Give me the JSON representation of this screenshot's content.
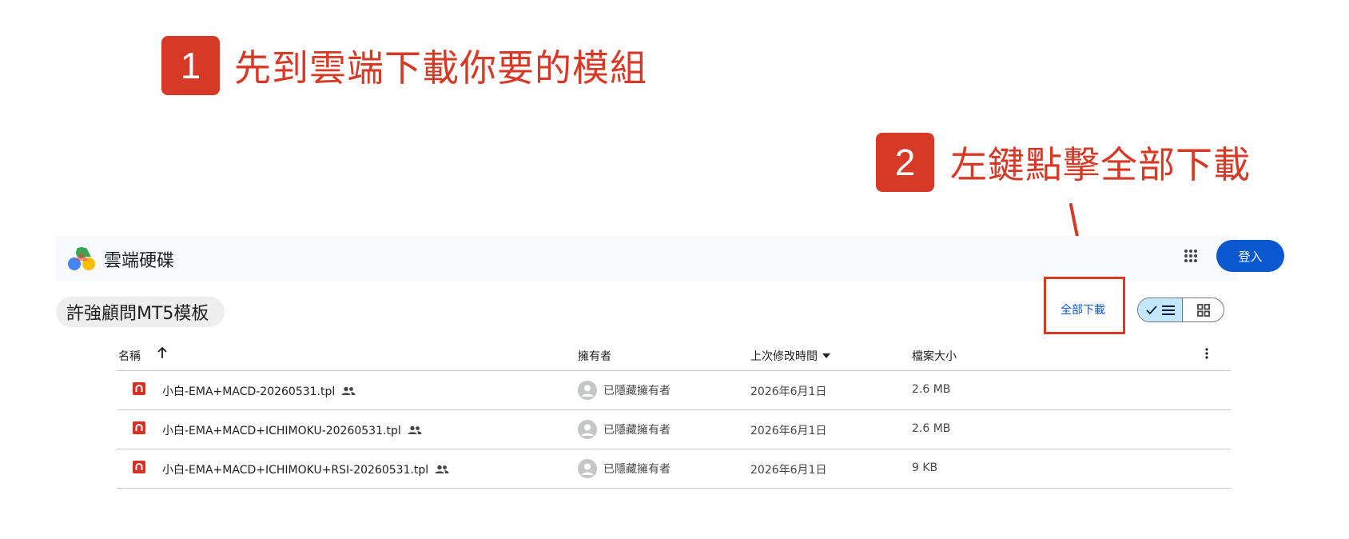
{
  "steps": [
    {
      "number": "1",
      "text": "先到雲端下載你要的模組"
    },
    {
      "number": "2",
      "text": "左鍵點擊全部下載"
    }
  ],
  "header": {
    "app_name": "雲端硬碟",
    "login_label": "登入"
  },
  "folder": {
    "title": "許強顧問MT5模板"
  },
  "toolbar": {
    "download_all_label": "全部下載"
  },
  "table": {
    "columns": {
      "name": "名稱",
      "owner": "擁有者",
      "modified": "上次修改時間",
      "size": "檔案大小"
    },
    "rows": [
      {
        "name": "小白-EMA+MACD-20260531.tpl",
        "owner": "已隱藏擁有者",
        "modified": "2026年6月1日",
        "size": "2.6 MB"
      },
      {
        "name": "小白-EMA+MACD+ICHIMOKU-20260531.tpl",
        "owner": "已隱藏擁有者",
        "modified": "2026年6月1日",
        "size": "2.6 MB"
      },
      {
        "name": "小白-EMA+MACD+ICHIMOKU+RSI-20260531.tpl",
        "owner": "已隱藏擁有者",
        "modified": "2026年6月1日",
        "size": "9 KB"
      }
    ]
  },
  "colors": {
    "annotation_red": "#d63a26",
    "primary_blue": "#0b57d0",
    "toggle_selected": "#c2e7ff"
  },
  "icons": [
    "drive-logo",
    "apps-grid-icon",
    "sort-up-arrow-icon",
    "sort-down-caret-icon",
    "more-vert-icon",
    "file-icon",
    "shared-people-icon",
    "avatar-icon",
    "check-icon",
    "list-icon",
    "grid-icon"
  ]
}
